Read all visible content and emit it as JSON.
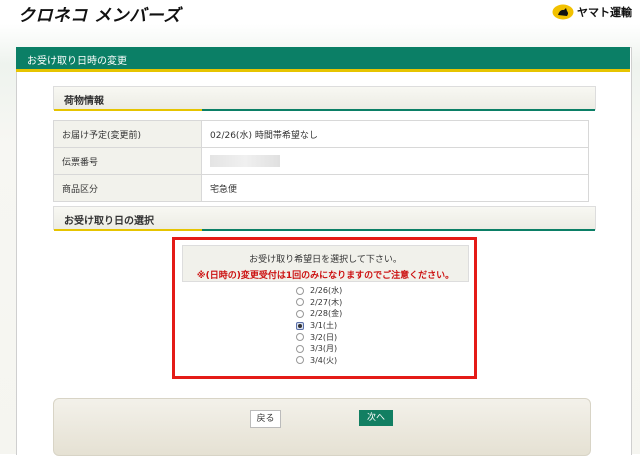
{
  "header": {
    "brand": "クロネコ メンバーズ",
    "company": "ヤマト運輸"
  },
  "panel": {
    "title": "お受け取り日時の変更"
  },
  "package_section": {
    "title": "荷物情報",
    "rows": [
      {
        "label": "お届け予定(変更前)",
        "value": "02/26(水) 時間帯希望なし"
      },
      {
        "label": "伝票番号",
        "value": ""
      },
      {
        "label": "商品区分",
        "value": "宅急便"
      }
    ]
  },
  "date_section": {
    "title": "お受け取り日の選択",
    "instruction": "お受け取り希望日を選択して下さい。",
    "warning": "※(日時の)変更受付は1回のみになりますのでご注意ください。",
    "options": [
      "2/26(水)",
      "2/27(木)",
      "2/28(金)",
      "3/1(土)",
      "3/2(日)",
      "3/3(月)",
      "3/4(火)"
    ],
    "selected": "3/1(土)"
  },
  "buttons": {
    "back": "戻る",
    "next": "次へ"
  }
}
